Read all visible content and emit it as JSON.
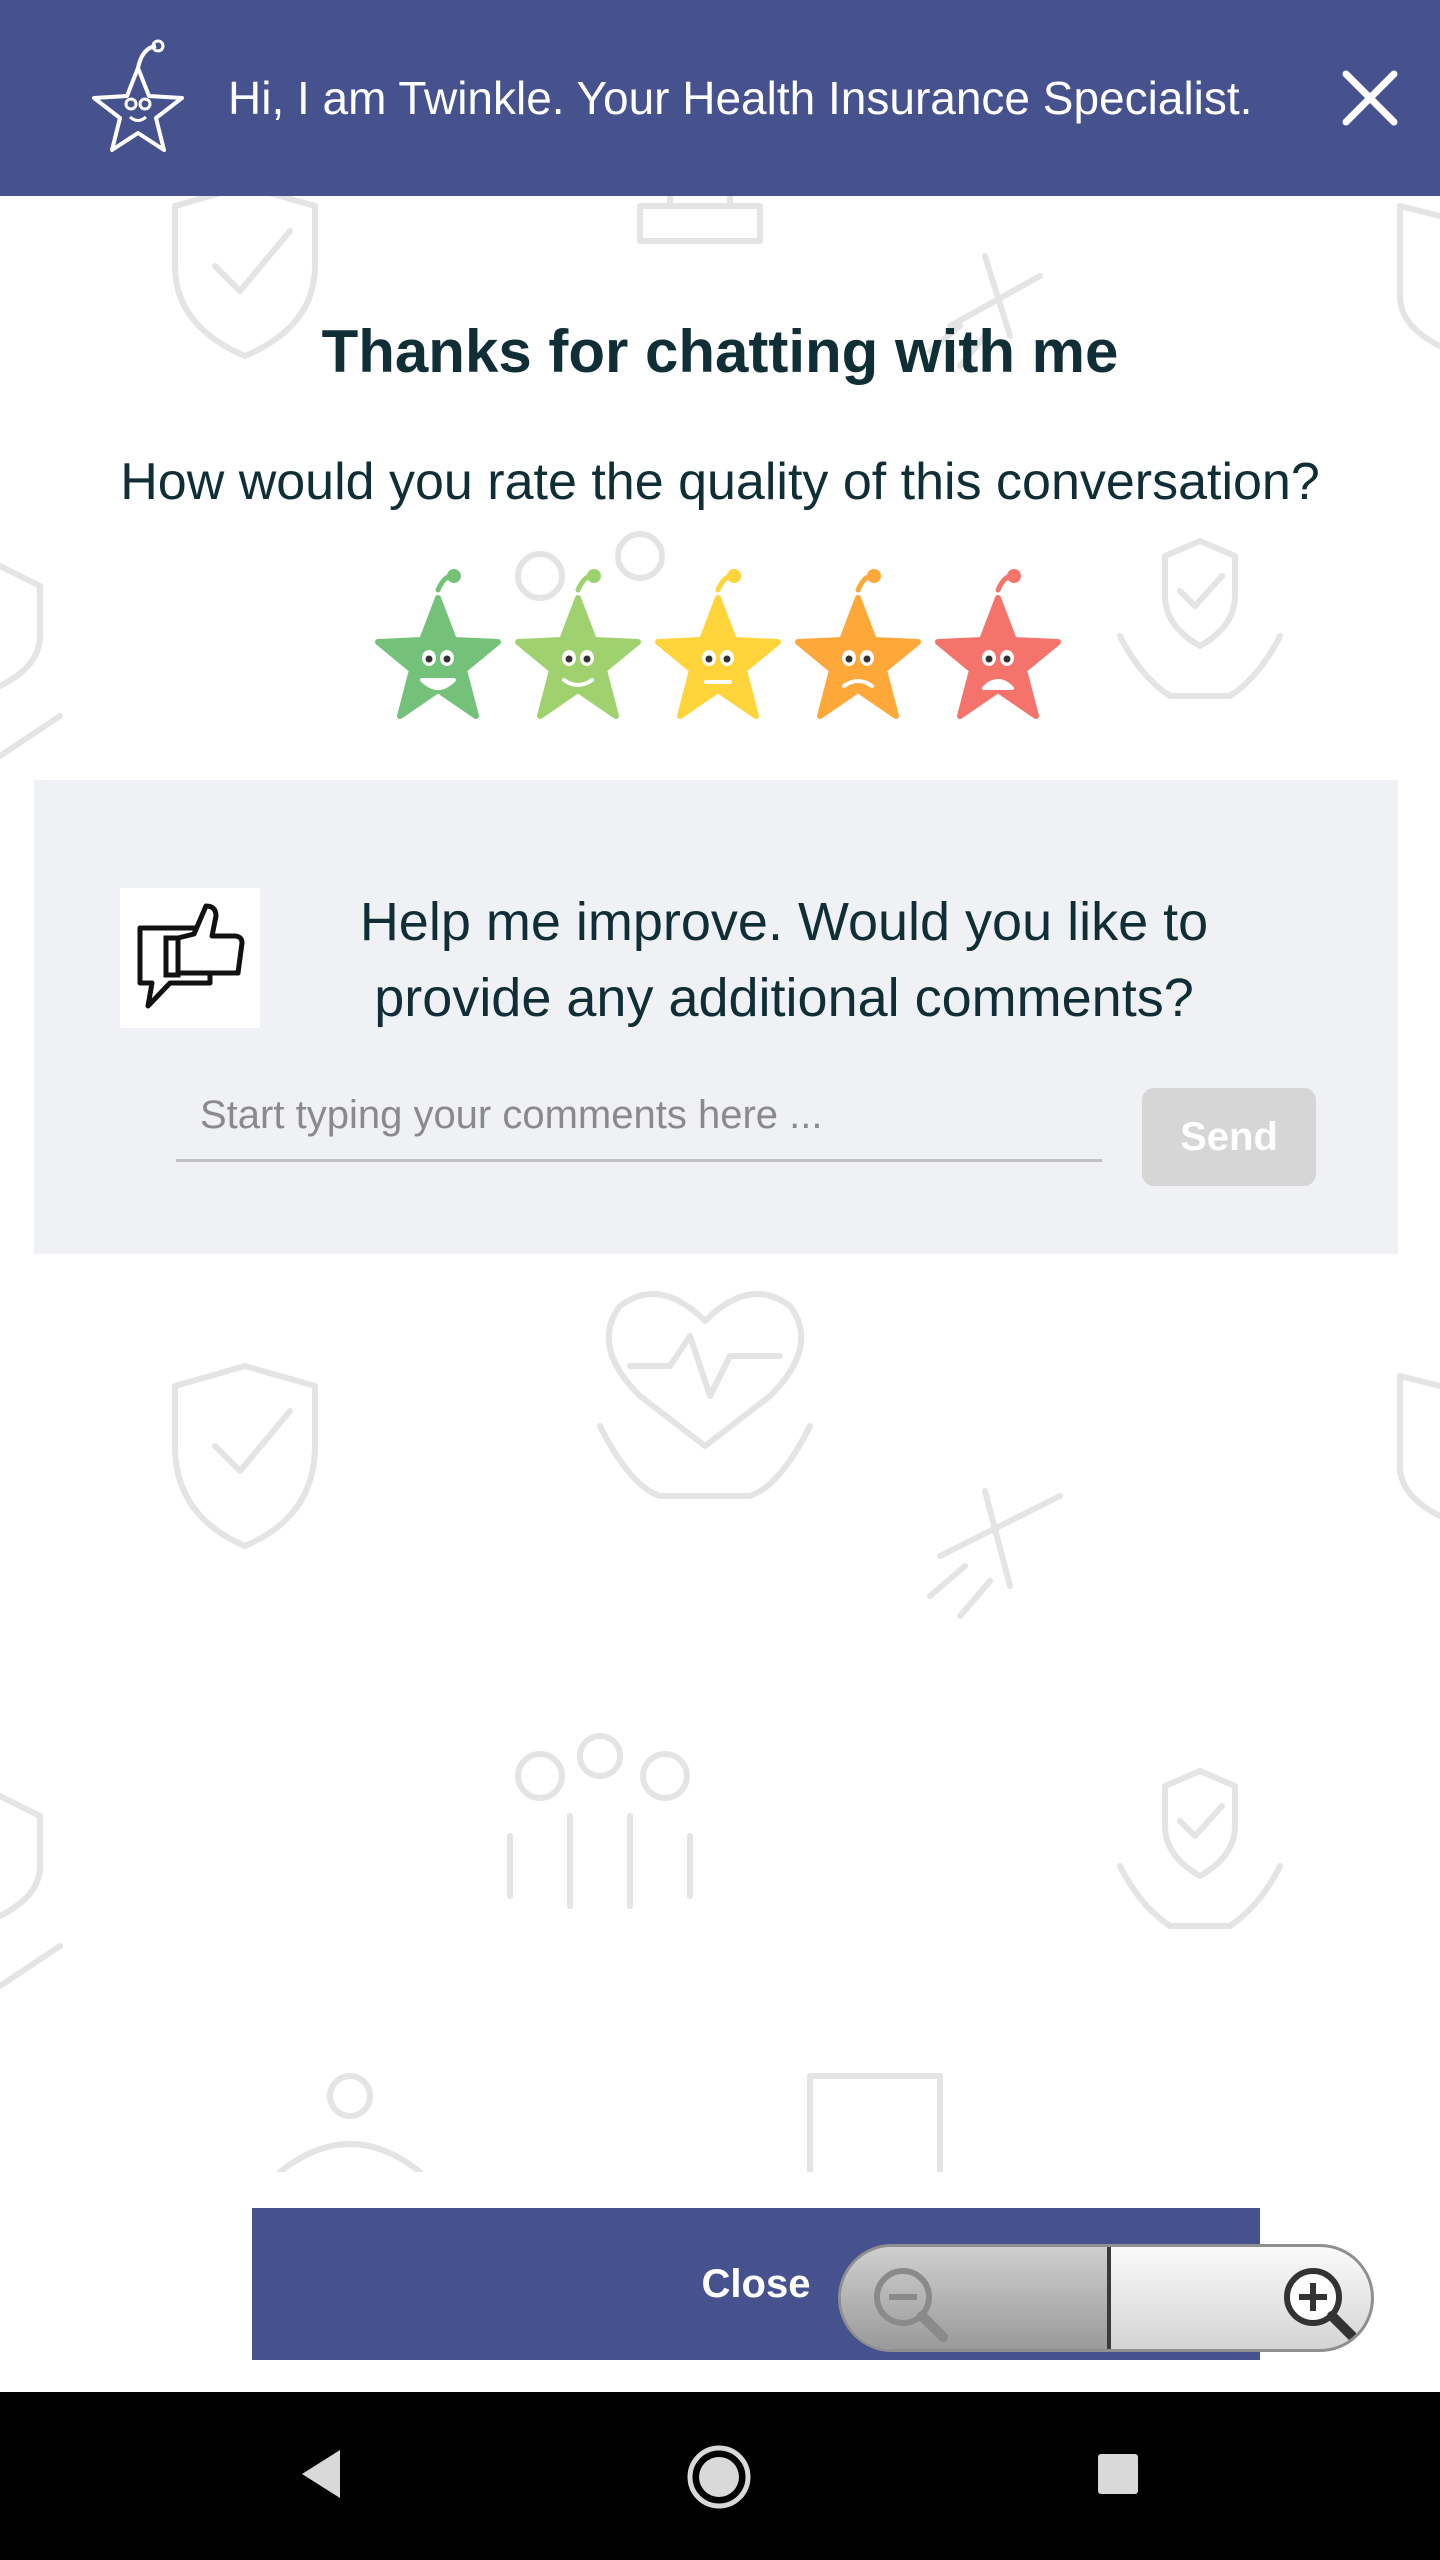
{
  "header": {
    "title": "Hi, I am Twinkle. Your Health Insurance Specialist.",
    "logo_icon": "star-mascot-icon",
    "close_icon": "close-icon",
    "background_color": "#46528e"
  },
  "survey": {
    "heading": "Thanks for chatting with me",
    "question": "How would you rate the quality of this conversation?",
    "ratings": [
      {
        "mood": "very-happy",
        "color": "#74c27a"
      },
      {
        "mood": "happy",
        "color": "#9fd26f"
      },
      {
        "mood": "neutral",
        "color": "#ffd43a"
      },
      {
        "mood": "sad",
        "color": "#ffa83a"
      },
      {
        "mood": "very-sad",
        "color": "#f4736b"
      }
    ]
  },
  "feedback": {
    "icon": "thumbs-up-chat-icon",
    "prompt": "Help me improve. Would you like to provide any additional comments?",
    "comment_value": "",
    "comment_placeholder": "Start typing your comments here ...",
    "send_label": "Send"
  },
  "footer": {
    "close_label": "Close"
  },
  "zoom_control": {
    "zoom_out_icon": "zoom-out-icon",
    "zoom_in_icon": "zoom-in-icon"
  },
  "navigation_bar": {
    "back_icon": "back-icon",
    "home_icon": "home-icon",
    "recents_icon": "recents-icon"
  }
}
